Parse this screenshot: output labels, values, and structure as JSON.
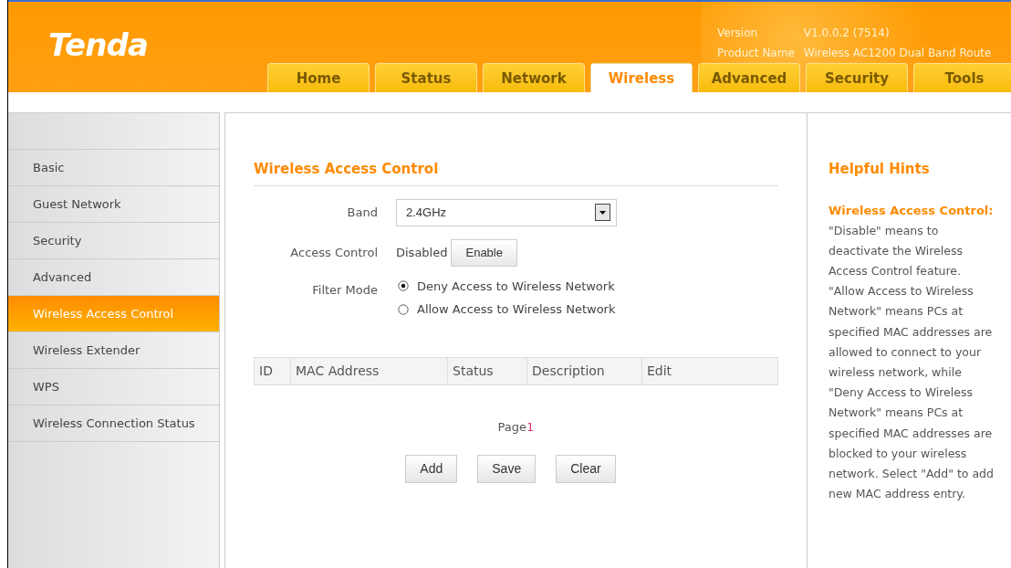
{
  "header": {
    "logo": "Tenda",
    "version_label": "Version",
    "version": "V1.0.0.2 (7514)",
    "product_label": "Product Name",
    "product": "Wireless AC1200 Dual Band Route"
  },
  "tabs": [
    {
      "label": "Home",
      "selected": false
    },
    {
      "label": "Status",
      "selected": false
    },
    {
      "label": "Network",
      "selected": false
    },
    {
      "label": "Wireless",
      "selected": true
    },
    {
      "label": "Advanced",
      "selected": false
    },
    {
      "label": "Security",
      "selected": false
    },
    {
      "label": "Tools",
      "selected": false
    }
  ],
  "sidebar": {
    "items": [
      {
        "label": "Basic",
        "selected": false
      },
      {
        "label": "Guest Network",
        "selected": false
      },
      {
        "label": "Security",
        "selected": false
      },
      {
        "label": "Advanced",
        "selected": false
      },
      {
        "label": "Wireless Access Control",
        "selected": true
      },
      {
        "label": "Wireless Extender",
        "selected": false
      },
      {
        "label": "WPS",
        "selected": false
      },
      {
        "label": "Wireless Connection Status",
        "selected": false
      }
    ]
  },
  "main": {
    "title": "Wireless Access Control",
    "band": {
      "label": "Band",
      "value": "2.4GHz"
    },
    "access_control": {
      "label": "Access Control",
      "status": "Disabled",
      "button": "Enable"
    },
    "filter_mode": {
      "label": "Filter Mode",
      "options": [
        {
          "label": "Deny Access to Wireless Network",
          "selected": true
        },
        {
          "label": "Allow Access to Wireless Network",
          "selected": false
        }
      ]
    },
    "table": {
      "columns": [
        "ID",
        "MAC Address",
        "Status",
        "Description",
        "Edit"
      ]
    },
    "pagination": {
      "label": "Page",
      "current": "1"
    },
    "buttons": [
      "Add",
      "Save",
      "Clear"
    ]
  },
  "hints": {
    "title": "Helpful Hints",
    "subtitle": "Wireless Access Control:",
    "text": "\"Disable\" means to deactivate the Wireless Access Control feature. \"Allow Access to Wireless Network\" means PCs at specified MAC addresses are allowed to connect to your wireless network, while \"Deny Access to Wireless Network\" means PCs at specified MAC addresses are blocked to your wireless network. Select \"Add\" to add new MAC address entry."
  }
}
